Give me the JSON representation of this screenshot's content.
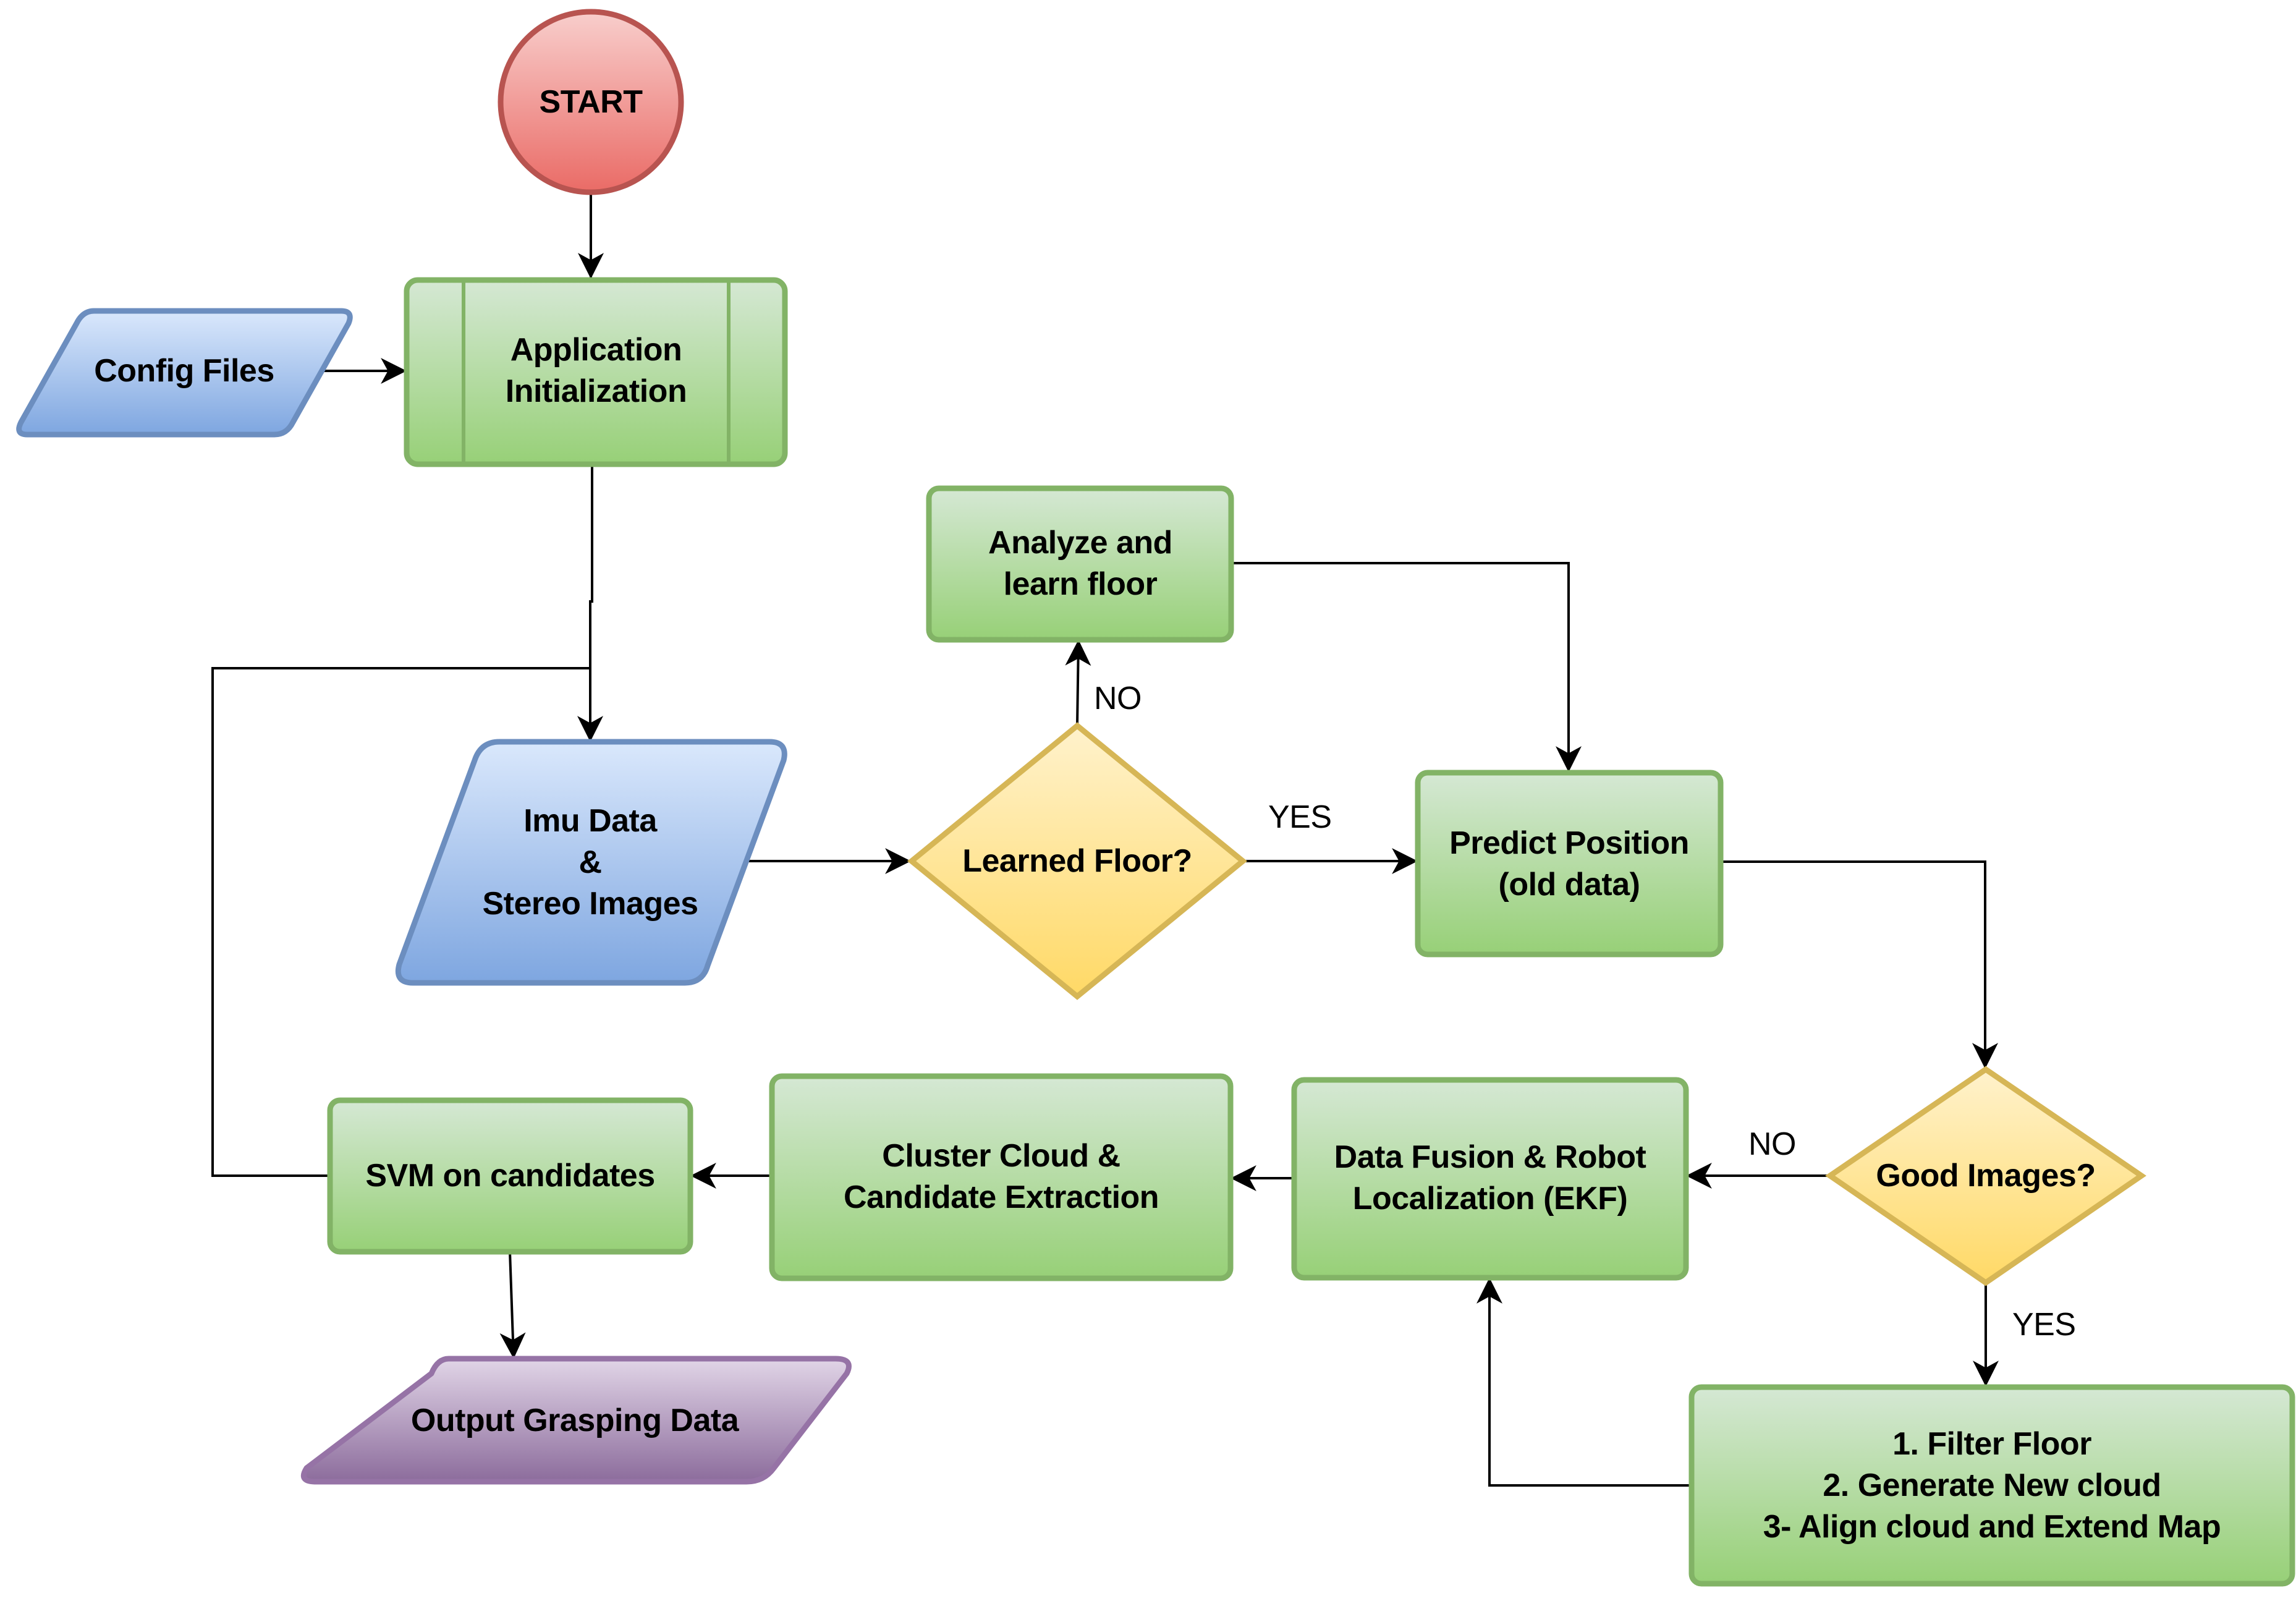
{
  "diagram": {
    "type": "flowchart",
    "colors": {
      "start_fill_top": "#f8cecc",
      "start_fill_bottom": "#ea6b66",
      "start_stroke": "#b85450",
      "process_fill_top": "#d5e8d4",
      "process_fill_bottom": "#97d077",
      "process_stroke": "#82b366",
      "io_fill_top": "#dae8fc",
      "io_fill_bottom": "#7ea6e0",
      "io_stroke": "#6c8ebf",
      "decision_fill_top": "#fff2cc",
      "decision_fill_bottom": "#ffd966",
      "decision_stroke": "#d6b656",
      "output_fill_top": "#e1d5e7",
      "output_fill_bottom": "#8c6c9c",
      "output_stroke": "#9673a6",
      "connector": "#000000"
    },
    "nodes": {
      "start": {
        "shape": "terminator-circle",
        "lines": [
          "START"
        ]
      },
      "app_init": {
        "shape": "predefined-process",
        "lines": [
          "Application",
          "Initialization"
        ]
      },
      "config_files": {
        "shape": "data-input",
        "lines": [
          "Config Files"
        ]
      },
      "imu_stereo": {
        "shape": "data-input",
        "lines": [
          "Imu Data",
          "&",
          "Stereo Images"
        ]
      },
      "analyze_floor": {
        "shape": "process",
        "lines": [
          "Analyze and",
          "learn floor"
        ]
      },
      "learned_floor": {
        "shape": "decision",
        "lines": [
          "Learned Floor?"
        ]
      },
      "predict_position": {
        "shape": "process",
        "lines": [
          "Predict Position",
          "(old data)"
        ]
      },
      "good_images": {
        "shape": "decision",
        "lines": [
          "Good Images?"
        ]
      },
      "data_fusion": {
        "shape": "process",
        "lines": [
          "Data Fusion & Robot",
          "Localization (EKF)"
        ]
      },
      "cluster_cloud": {
        "shape": "process",
        "lines": [
          "Cluster Cloud &",
          "Candidate Extraction"
        ]
      },
      "svm": {
        "shape": "process",
        "lines": [
          "SVM on candidates"
        ]
      },
      "output_grasping": {
        "shape": "data-output",
        "lines": [
          "Output Grasping Data"
        ]
      },
      "filter_floor": {
        "shape": "process",
        "lines": [
          "1. Filter Floor",
          "2. Generate New cloud",
          "3- Align cloud and Extend Map"
        ]
      }
    },
    "edges": [
      {
        "from": "start",
        "to": "app_init",
        "label": ""
      },
      {
        "from": "config_files",
        "to": "app_init",
        "label": ""
      },
      {
        "from": "app_init",
        "to": "imu_stereo",
        "label": ""
      },
      {
        "from": "svm",
        "to": "imu_stereo",
        "label": ""
      },
      {
        "from": "imu_stereo",
        "to": "learned_floor",
        "label": ""
      },
      {
        "from": "learned_floor",
        "to": "analyze_floor",
        "label": "NO"
      },
      {
        "from": "learned_floor",
        "to": "predict_position",
        "label": "YES"
      },
      {
        "from": "analyze_floor",
        "to": "predict_position",
        "label": ""
      },
      {
        "from": "predict_position",
        "to": "good_images",
        "label": ""
      },
      {
        "from": "good_images",
        "to": "data_fusion",
        "label": "NO"
      },
      {
        "from": "good_images",
        "to": "filter_floor",
        "label": "YES"
      },
      {
        "from": "filter_floor",
        "to": "data_fusion",
        "label": ""
      },
      {
        "from": "data_fusion",
        "to": "cluster_cloud",
        "label": ""
      },
      {
        "from": "cluster_cloud",
        "to": "svm",
        "label": ""
      },
      {
        "from": "svm",
        "to": "output_grasping",
        "label": ""
      }
    ]
  }
}
